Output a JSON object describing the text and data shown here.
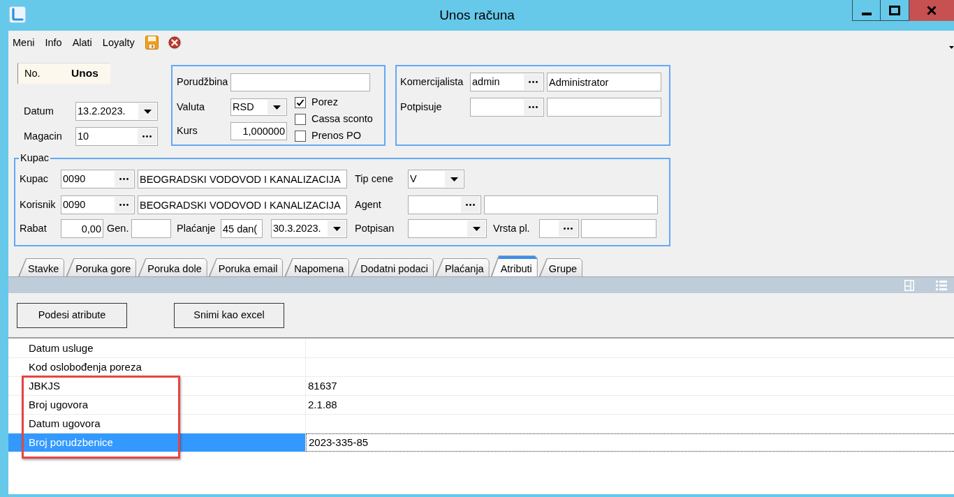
{
  "window": {
    "title": "Unos računa"
  },
  "menu": [
    {
      "label": "Meni"
    },
    {
      "label": "Info"
    },
    {
      "label": "Alati"
    },
    {
      "label": "Loyalty"
    }
  ],
  "document": {
    "label": "No.",
    "value": "Unos"
  },
  "header_fields": [
    {
      "label": "Datum",
      "kind": "date",
      "value": "13.2.2023."
    },
    {
      "label": "Magacin",
      "kind": "lookup",
      "value": "10"
    }
  ],
  "order_panel": {
    "fields": [
      {
        "label": "Porudžbina",
        "kind": "text"
      },
      {
        "label": "Valuta",
        "kind": "combo",
        "value": "RSD"
      },
      {
        "label": "Kurs",
        "kind": "number",
        "value": "1,000000"
      }
    ],
    "options": [
      {
        "label": "Porez",
        "checked": true
      },
      {
        "label": "Cassa sconto",
        "checked": false
      },
      {
        "label": "Prenos PO",
        "checked": false
      }
    ]
  },
  "staff_panel": {
    "rows": [
      {
        "label": "Komercijalista",
        "code": "admin",
        "name": "Administrator"
      },
      {
        "label": "Potpisuje"
      }
    ]
  },
  "customer_panel": {
    "legend": "Kupac",
    "rows": [
      {
        "items": [
          {
            "kind": "label",
            "text": "Kupac"
          },
          {
            "kind": "lookup",
            "value": "0090"
          },
          {
            "kind": "text",
            "value": "BEOGRADSKI VODOVOD I KANALIZACIJA"
          },
          {
            "kind": "label",
            "text": "Tip cene"
          },
          {
            "kind": "combo",
            "value": "V"
          }
        ]
      },
      {
        "items": [
          {
            "kind": "label",
            "text": "Korisnik"
          },
          {
            "kind": "lookup",
            "value": "0090"
          },
          {
            "kind": "text",
            "value": "BEOGRADSKI VODOVOD I KANALIZACIJA"
          },
          {
            "kind": "label",
            "text": "Agent"
          },
          {
            "kind": "lookup"
          },
          {
            "kind": "text"
          }
        ]
      },
      {
        "items": [
          {
            "kind": "label",
            "text": "Rabat"
          },
          {
            "kind": "number",
            "value": "0,00"
          },
          {
            "kind": "label",
            "text": "Gen."
          },
          {
            "kind": "text"
          },
          {
            "kind": "label",
            "text": "Plaćanje"
          },
          {
            "kind": "text",
            "value": "45 dan("
          },
          {
            "kind": "date",
            "value": "30.3.2023."
          },
          {
            "kind": "label",
            "text": "Potpisan"
          },
          {
            "kind": "combo"
          },
          {
            "kind": "label",
            "text": "Vrsta pl."
          },
          {
            "kind": "lookup"
          },
          {
            "kind": "text"
          }
        ]
      }
    ]
  },
  "tabs": [
    {
      "label": "Stavke",
      "selected": false
    },
    {
      "label": "Poruka gore",
      "selected": false
    },
    {
      "label": "Poruka dole",
      "selected": false
    },
    {
      "label": "Poruka email",
      "selected": false
    },
    {
      "label": "Napomena",
      "selected": false
    },
    {
      "label": "Dodatni podaci",
      "selected": false
    },
    {
      "label": "Plaćanja",
      "selected": false
    },
    {
      "label": "Atributi",
      "selected": true
    },
    {
      "label": "Grupe",
      "selected": false
    }
  ],
  "buttons": [
    {
      "label": "Podesi atribute"
    },
    {
      "label": "Snimi kao excel"
    }
  ],
  "attributes": {
    "rows": [
      {
        "name": "Datum usluge",
        "selected": false,
        "highlighted": false
      },
      {
        "name": "Kod oslobođenja poreza",
        "selected": false,
        "highlighted": false
      },
      {
        "name": "JBKJS",
        "value": "81637",
        "selected": false,
        "highlighted": true
      },
      {
        "name": "Broj ugovora",
        "value": "2.1.88",
        "selected": false,
        "highlighted": true
      },
      {
        "name": "Datum ugovora",
        "selected": false,
        "highlighted": true
      },
      {
        "name": "Broj porudzbenice",
        "value": "2023-335-85",
        "selected": true,
        "highlighted": true
      }
    ]
  }
}
